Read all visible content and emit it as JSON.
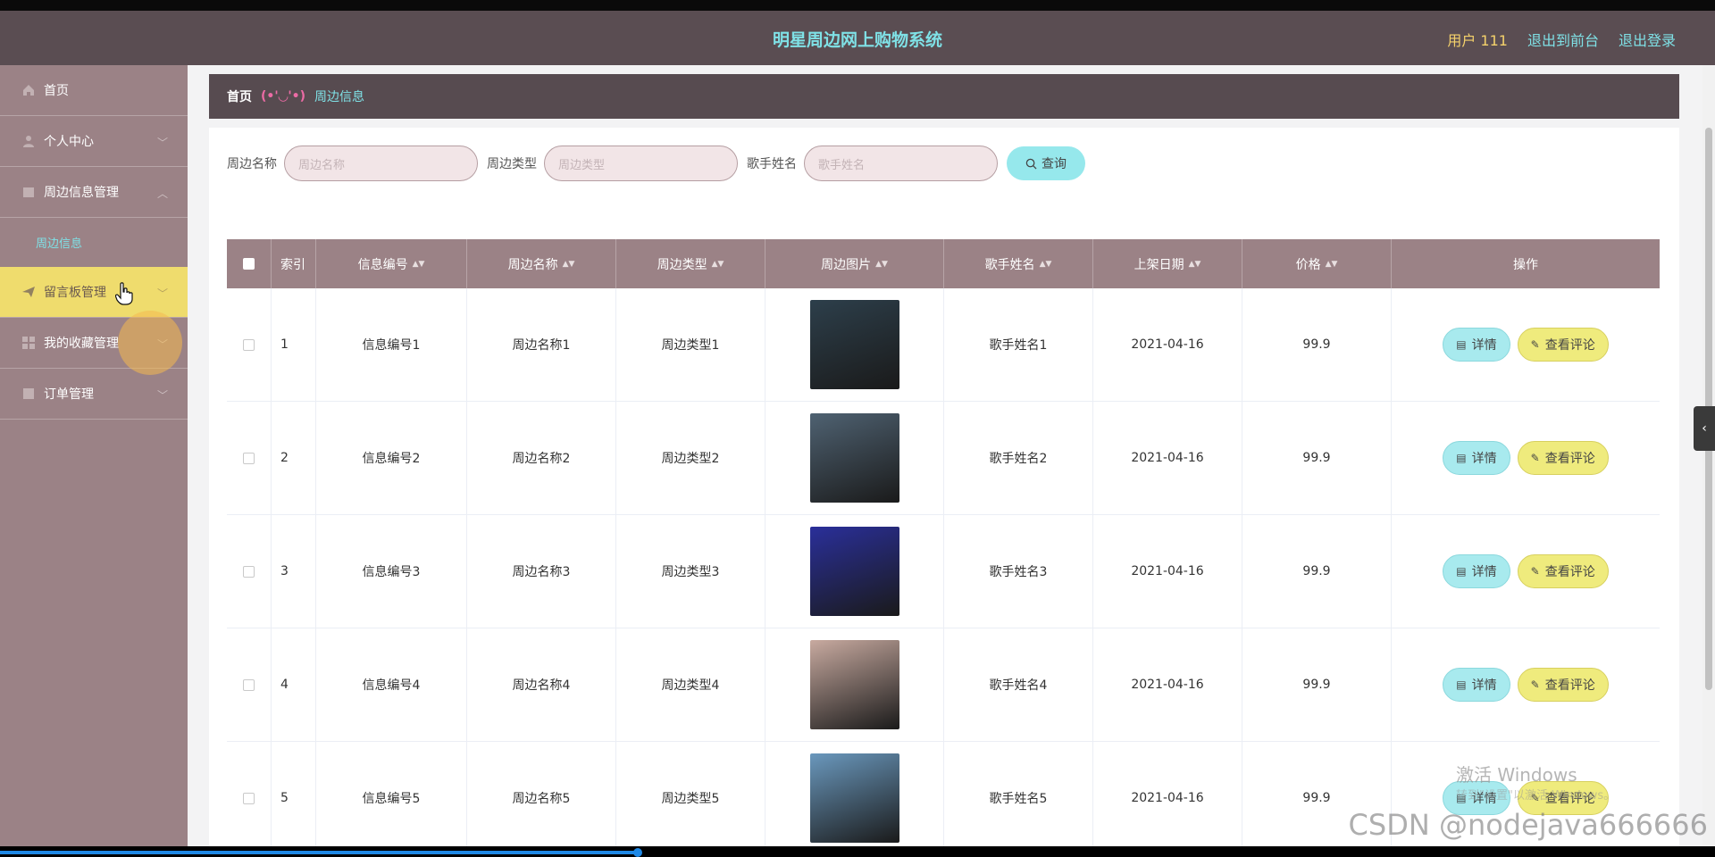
{
  "header": {
    "title": "明星周边网上购物系统",
    "user": "用户 111",
    "to_front": "退出到前台",
    "logout": "退出登录"
  },
  "sidebar": {
    "items": [
      {
        "label": "首页",
        "icon": "home-icon"
      },
      {
        "label": "个人中心",
        "icon": "user-icon"
      },
      {
        "label": "周边信息管理",
        "icon": "box-icon"
      },
      {
        "label": "周边信息",
        "sub": true
      },
      {
        "label": "留言板管理",
        "icon": "send-icon",
        "active": true
      },
      {
        "label": "我的收藏管理",
        "icon": "grid-icon"
      },
      {
        "label": "订单管理",
        "icon": "order-icon"
      }
    ]
  },
  "breadcrumb": {
    "home": "首页",
    "sep": "(•'◡'•)",
    "current": "周边信息"
  },
  "search": {
    "name_label": "周边名称",
    "name_placeholder": "周边名称",
    "type_label": "周边类型",
    "type_placeholder": "周边类型",
    "singer_label": "歌手姓名",
    "singer_placeholder": "歌手姓名",
    "button": "查询"
  },
  "table": {
    "headers": [
      "索引",
      "信息编号",
      "周边名称",
      "周边类型",
      "周边图片",
      "歌手姓名",
      "上架日期",
      "价格",
      "操作"
    ],
    "rows": [
      {
        "idx": "1",
        "code": "信息编号1",
        "name": "周边名称1",
        "type": "周边类型1",
        "singer": "歌手姓名1",
        "date": "2021-04-16",
        "price": "99.9",
        "img": "#2d3f4b"
      },
      {
        "idx": "2",
        "code": "信息编号2",
        "name": "周边名称2",
        "type": "周边类型2",
        "singer": "歌手姓名2",
        "date": "2021-04-16",
        "price": "99.9",
        "img": "#4f6272"
      },
      {
        "idx": "3",
        "code": "信息编号3",
        "name": "周边名称3",
        "type": "周边类型3",
        "singer": "歌手姓名3",
        "date": "2021-04-16",
        "price": "99.9",
        "img": "#2a2f9a"
      },
      {
        "idx": "4",
        "code": "信息编号4",
        "name": "周边名称4",
        "type": "周边类型4",
        "singer": "歌手姓名4",
        "date": "2021-04-16",
        "price": "99.9",
        "img": "#c8aaa0"
      },
      {
        "idx": "5",
        "code": "信息编号5",
        "name": "周边名称5",
        "type": "周边类型5",
        "singer": "歌手姓名5",
        "date": "2021-04-16",
        "price": "99.9",
        "img": "#6a98bd"
      }
    ],
    "detail_label": "详情",
    "review_label": "查看评论"
  },
  "overlay": {
    "activate_windows": "激活 Windows",
    "activate_hint": "转到\"设置\"以激活 Windows。",
    "csdn": "CSDN @nodejava666666"
  }
}
